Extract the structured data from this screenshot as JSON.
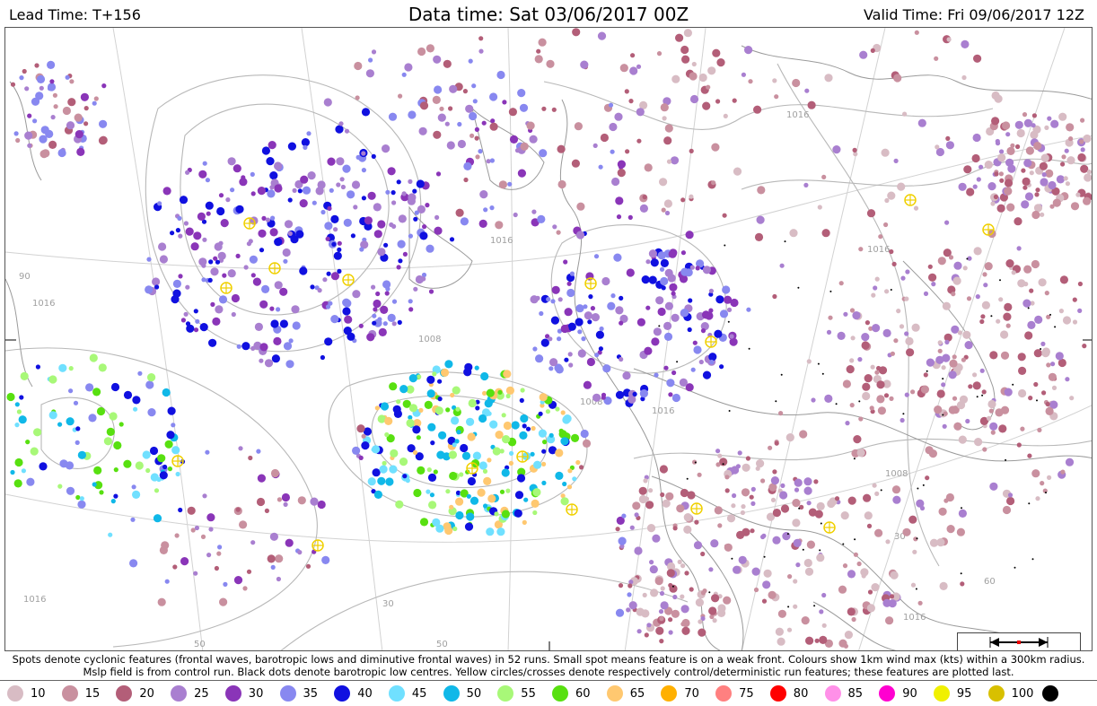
{
  "header": {
    "lead_time": "Lead Time: T+156",
    "data_time": "Data time:  Sat 03/06/2017 00Z",
    "valid_time": "Valid Time: Fri 09/06/2017 12Z"
  },
  "map": {
    "isobar_labels": [
      "1016",
      "1016",
      "1008",
      "1008",
      "1016",
      "1016",
      "1016",
      "1008",
      "1016",
      "30",
      "30",
      "50",
      "50",
      "90",
      "60",
      "1016"
    ],
    "land_color": "#9a9a9a",
    "isobar_color": "#b8b8b8"
  },
  "caption": {
    "line1": "Spots denote cyclonic features (frontal waves, barotropic lows and diminutive frontal waves) in 52 runs. Small spot means feature is on a weak front. Colours show 1km wind max (kts) within a 300km radius.",
    "line2": "Mslp field is from control run. Black dots denote barotropic low centres. Yellow circles/crosses denote respectively control/deterministic run features; these features are plotted last."
  },
  "legend": [
    {
      "label": "10",
      "color": "#d8bcc4"
    },
    {
      "label": "15",
      "color": "#c9909f"
    },
    {
      "label": "20",
      "color": "#b35e78"
    },
    {
      "label": "25",
      "color": "#a97fd0"
    },
    {
      "label": "30",
      "color": "#8a35b8"
    },
    {
      "label": "35",
      "color": "#8888f0"
    },
    {
      "label": "40",
      "color": "#1010e0"
    },
    {
      "label": "45",
      "color": "#70e0ff"
    },
    {
      "label": "50",
      "color": "#10b8e8"
    },
    {
      "label": "55",
      "color": "#a8f878"
    },
    {
      "label": "60",
      "color": "#58e010"
    },
    {
      "label": "65",
      "color": "#ffc870"
    },
    {
      "label": "70",
      "color": "#ffb000"
    },
    {
      "label": "75",
      "color": "#ff8080"
    },
    {
      "label": "80",
      "color": "#ff0000"
    },
    {
      "label": "85",
      "color": "#ff90e8"
    },
    {
      "label": "90",
      "color": "#ff00d0"
    },
    {
      "label": "95",
      "color": "#f0f000"
    },
    {
      "label": "100",
      "color": "#d8c000"
    },
    {
      "label": "",
      "color": "#000000"
    }
  ]
}
